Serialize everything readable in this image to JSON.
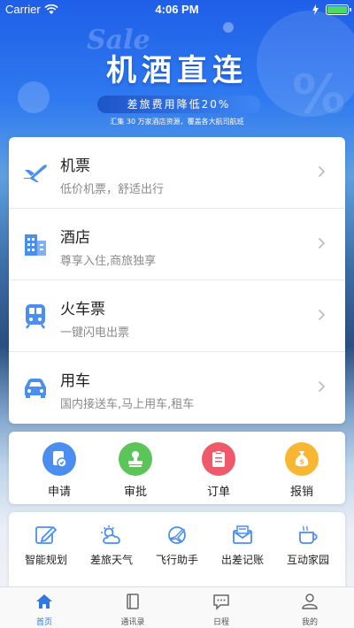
{
  "status_bar": {
    "carrier": "Carrier",
    "time": "4:06 PM"
  },
  "banner": {
    "sale_text": "Sale",
    "title": "机酒直连",
    "subtitle": "差旅费用降低20%",
    "caption": "汇集 30 万家酒店资源，覆盖各大航司航班",
    "watermark": "%"
  },
  "services": [
    {
      "name": "机票",
      "desc": "低价机票，舒适出行",
      "icon": "airplane-icon"
    },
    {
      "name": "酒店",
      "desc": "尊享入住,商旅独享",
      "icon": "hotel-building-icon"
    },
    {
      "name": "火车票",
      "desc": "一键闪电出票",
      "icon": "train-icon"
    },
    {
      "name": "用车",
      "desc": "国内接送车,马上用车,租车",
      "icon": "car-icon"
    }
  ],
  "functions": [
    {
      "label": "申请",
      "icon": "application-doc-icon",
      "color": "#4a8ff0"
    },
    {
      "label": "审批",
      "icon": "approval-stamp-icon",
      "color": "#5cc55a"
    },
    {
      "label": "订单",
      "icon": "order-clipboard-icon",
      "color": "#ef5a6a"
    },
    {
      "label": "报销",
      "icon": "money-bag-icon",
      "color": "#f7b733"
    }
  ],
  "tools": [
    {
      "label": "智能规划",
      "icon": "edit-plan-icon"
    },
    {
      "label": "差旅天气",
      "icon": "weather-icon"
    },
    {
      "label": "飞行助手",
      "icon": "flight-assistant-icon"
    },
    {
      "label": "出差记账",
      "icon": "mail-ledger-icon"
    },
    {
      "label": "互动家园",
      "icon": "coffee-cup-icon"
    }
  ],
  "tabs": [
    {
      "label": "首页",
      "icon": "home-icon",
      "active": true
    },
    {
      "label": "通讯录",
      "icon": "contacts-book-icon",
      "active": false
    },
    {
      "label": "日程",
      "icon": "schedule-chat-icon",
      "active": false
    },
    {
      "label": "我的",
      "icon": "profile-person-icon",
      "active": false
    }
  ],
  "colors": {
    "accent": "#2f78e6",
    "icon_blue": "#4a8ff0"
  }
}
